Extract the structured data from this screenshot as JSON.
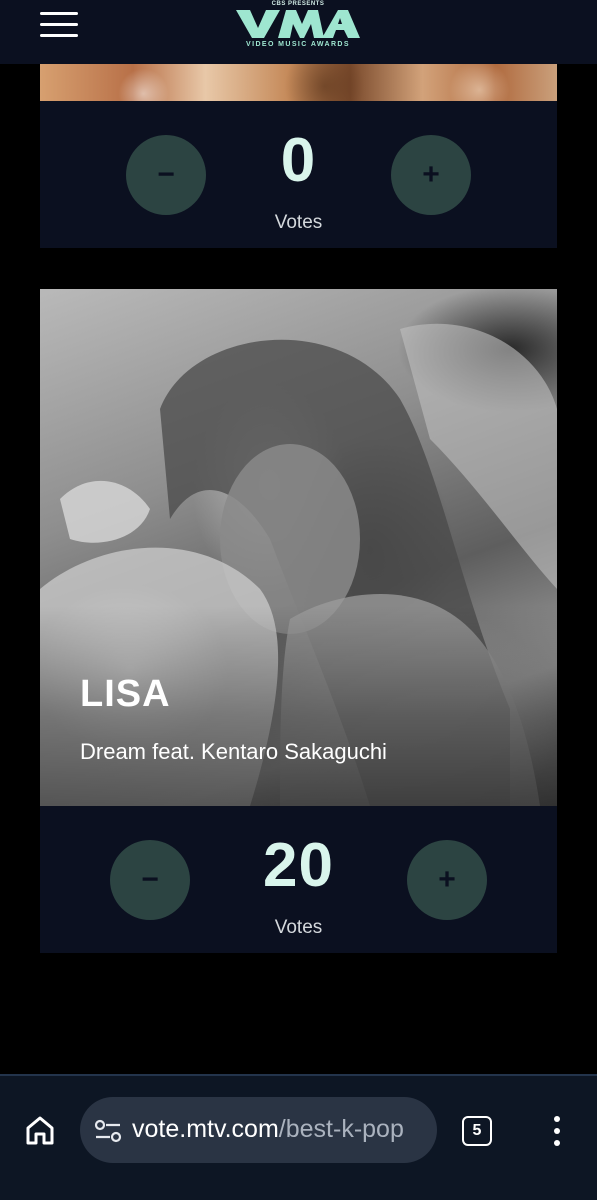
{
  "header": {
    "logo_top": "CBS PRESENTS",
    "logo_mark": "VMA",
    "logo_sub": "VIDEO MUSIC AWARDS",
    "menu_icon": "hamburger-menu-icon"
  },
  "nominees": [
    {
      "artist": "",
      "song": "",
      "votes": "0",
      "votes_label": "Votes",
      "minus_label": "−",
      "plus_label": "+"
    },
    {
      "artist": "LISA",
      "song": "Dream feat. Kentaro Sakaguchi",
      "votes": "20",
      "votes_label": "Votes",
      "minus_label": "−",
      "plus_label": "+"
    }
  ],
  "browser": {
    "url_host": "vote.mtv.com",
    "url_path": "/best-k-pop",
    "tab_count": "5",
    "home_icon": "home-icon",
    "site_settings_icon": "tune-icon",
    "menu_icon": "more-vert-icon"
  },
  "colors": {
    "background": "#000000",
    "panel": "#0b1020",
    "button": "#2c4442",
    "count": "#d9f5ec",
    "logo_accent": "#9ee6d0"
  }
}
